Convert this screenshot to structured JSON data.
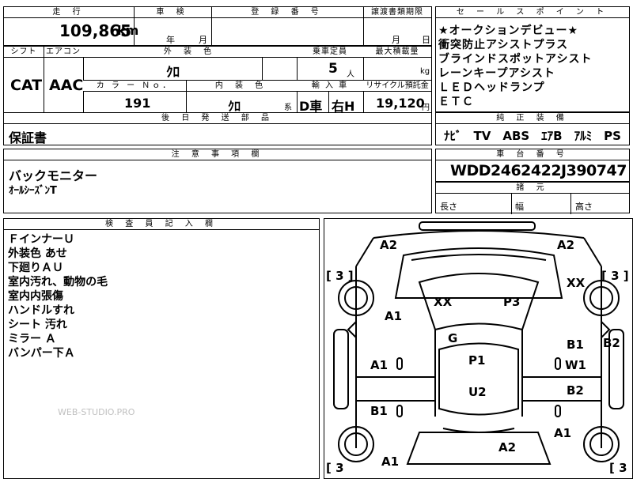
{
  "top": {
    "mileage_h": "走 行",
    "mileage": "109,865",
    "mileage_unit": "km",
    "shaken_h": "車 検",
    "year_unit": "年",
    "month_unit": "月",
    "reg_h": "登 録 番 号",
    "doc_h": "譲渡書類期限",
    "doc_month": "月",
    "doc_day": "日"
  },
  "row2": {
    "shift_h": "シフト",
    "shift": "CAT",
    "ac_h": "エアコン",
    "ac": "AAC",
    "ext_color_h": "外 装 色",
    "ext_color": "ｸﾛ",
    "capacity_h": "乗車定員",
    "capacity": "5",
    "capacity_unit": "人",
    "load_h": "最大積載量",
    "load_unit": "kg"
  },
  "row3": {
    "colorno_h": "カ ラ ー Ｎｏ．",
    "colorno": "191",
    "int_color_h": "内 装 色",
    "int_color": "ｸﾛ",
    "int_suffix": "系",
    "import_h": "輸 入 車",
    "import_type": "D車",
    "handle": "右H",
    "recycle_h": "リサイクル預託金",
    "recycle": "19,120",
    "recycle_unit": "円"
  },
  "parts": {
    "header": "後 日 発 送 部 品",
    "text": "保証書"
  },
  "sales": {
    "header": "セ ー ル ス ポ イ ン ト",
    "lines": [
      "★オークションデビュー★",
      "衝突防止アシストプラス",
      "ブラインドスポットアシスト",
      "レーンキープアシスト",
      "ＬＥＤヘッドランプ",
      "ＥＴＣ"
    ]
  },
  "equip": {
    "header": "純 正 装 備",
    "text": "ﾅﾋﾞ　TV　ABS　ｴｱB　ｱﾙﾐ　PS　PW"
  },
  "caution": {
    "header": "注 意 事 項 欄",
    "lines": [
      "バックモニター",
      "ｵｰﾙｼｰｽﾞﾝT"
    ]
  },
  "chassis": {
    "header": "車 台 番 号",
    "vin": "WDD2462422J390747"
  },
  "dims": {
    "header": "諸 元",
    "length": "長さ",
    "width": "幅",
    "height": "高さ"
  },
  "inspector": {
    "header": "検 査 員 記 入 欄",
    "lines": [
      "ＦインナーＵ",
      "外装色 あせ",
      "下廻りＡＵ",
      "室内汚れ、動物の毛",
      "室内内張傷",
      "ハンドルすれ",
      "シート 汚れ",
      "ミラー Ａ",
      "バンパー下Ａ"
    ]
  },
  "watermark": "WEB-STUDIO.PRO",
  "diagram": {
    "marks": {
      "a2_tl": "A2",
      "a2_tr": "A2",
      "xx_r": "XX",
      "xx_c": "XX",
      "p3": "P3",
      "a1_l": "A1",
      "g": "G",
      "b1_r": "B1",
      "b2_r": "B2",
      "a1_ml": "A1",
      "p1": "P1",
      "w1": "W1",
      "u2": "U2",
      "b2_mr": "B2",
      "b1_l": "B1",
      "a1_r": "A1",
      "a2_b": "A2",
      "a1_b": "A1"
    },
    "brackets": {
      "tl": "[ 3 ]",
      "tr": "[ 3 ]",
      "bl": "[ 3",
      "br": "[ 3"
    }
  }
}
